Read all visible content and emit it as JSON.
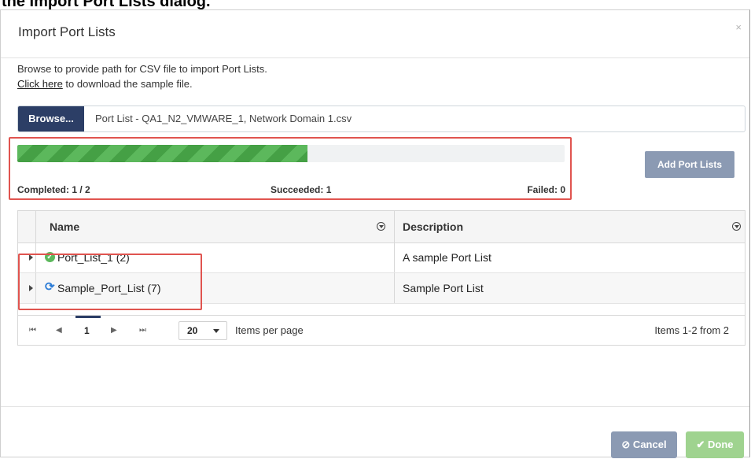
{
  "caption": "the Import Port Lists dialog.",
  "dialog": {
    "title": "Import Port Lists",
    "close_label": "×",
    "intro_line1": "Browse to provide path for CSV file to import Port Lists.",
    "intro_link": "Click here",
    "intro_line2_rest": " to download the sample file."
  },
  "file": {
    "browse_label": "Browse...",
    "filename": "Port List - QA1_N2_VMWARE_1, Network Domain 1.csv"
  },
  "progress": {
    "fraction": 0.53,
    "completed": "Completed: 1 / 2",
    "succeeded": "Succeeded: 1",
    "failed": "Failed: 0"
  },
  "add_button": "Add Port Lists",
  "grid": {
    "columns": [
      "Name",
      "Description"
    ],
    "rows": [
      {
        "name": "Port_List_1 (2)",
        "description": "A sample Port List",
        "status": "check-icon"
      },
      {
        "name": "Sample_Port_List (7)",
        "description": "Sample Port List",
        "status": "sync-icon"
      }
    ]
  },
  "pager": {
    "first": "⏮",
    "prev": "◀",
    "page": "1",
    "next": "▶",
    "last": "⏭",
    "page_size": "20",
    "items_per_page_label": "Items per page",
    "info": "Items 1-2 from 2"
  },
  "footer": {
    "cancel_label": "⊘ Cancel",
    "done_label": "✔ Done"
  },
  "colors": {
    "primary": "#2c3e66",
    "progress": "#5cb85c",
    "highlight": "#e0544f",
    "secondary_button": "#8b9ab3",
    "done_button": "#9fd38f"
  }
}
